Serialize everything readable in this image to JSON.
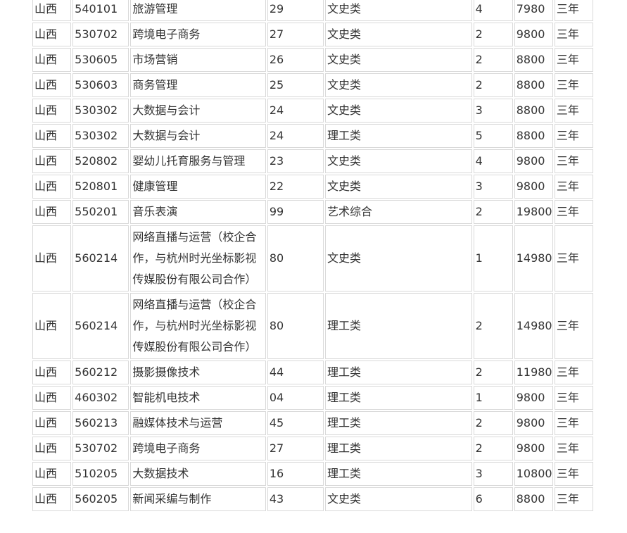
{
  "rows": [
    {
      "province": "山西",
      "code": "540101",
      "major": "旅游管理",
      "major_code": "29",
      "category": "文史类",
      "plan": "4",
      "fee": "7980",
      "years": "三年"
    },
    {
      "province": "山西",
      "code": "530702",
      "major": "跨境电子商务",
      "major_code": "27",
      "category": "文史类",
      "plan": "2",
      "fee": "9800",
      "years": "三年"
    },
    {
      "province": "山西",
      "code": "530605",
      "major": "市场营销",
      "major_code": "26",
      "category": "文史类",
      "plan": "2",
      "fee": "8800",
      "years": "三年"
    },
    {
      "province": "山西",
      "code": "530603",
      "major": "商务管理",
      "major_code": "25",
      "category": "文史类",
      "plan": "2",
      "fee": "8800",
      "years": "三年"
    },
    {
      "province": "山西",
      "code": "530302",
      "major": "大数据与会计",
      "major_code": "24",
      "category": "文史类",
      "plan": "3",
      "fee": "8800",
      "years": "三年"
    },
    {
      "province": "山西",
      "code": "530302",
      "major": "大数据与会计",
      "major_code": "24",
      "category": "理工类",
      "plan": "5",
      "fee": "8800",
      "years": "三年"
    },
    {
      "province": "山西",
      "code": "520802",
      "major": "婴幼儿托育服务与管理",
      "major_code": "23",
      "category": "文史类",
      "plan": "4",
      "fee": "9800",
      "years": "三年"
    },
    {
      "province": "山西",
      "code": "520801",
      "major": "健康管理",
      "major_code": "22",
      "category": "文史类",
      "plan": "3",
      "fee": "9800",
      "years": "三年"
    },
    {
      "province": "山西",
      "code": "550201",
      "major": "音乐表演",
      "major_code": "99",
      "category": "艺术综合",
      "plan": "2",
      "fee": "19800",
      "years": "三年"
    },
    {
      "province": "山西",
      "code": "560214",
      "major": "网络直播与运营（校企合作，与杭州时光坐标影视传媒股份有限公司合作）",
      "major_code": "80",
      "category": "文史类",
      "plan": "1",
      "fee": "14980",
      "years": "三年"
    },
    {
      "province": "山西",
      "code": "560214",
      "major": "网络直播与运营（校企合作，与杭州时光坐标影视传媒股份有限公司合作）",
      "major_code": "80",
      "category": "理工类",
      "plan": "2",
      "fee": "14980",
      "years": "三年"
    },
    {
      "province": "山西",
      "code": "560212",
      "major": "摄影摄像技术",
      "major_code": "44",
      "category": "理工类",
      "plan": "2",
      "fee": "11980",
      "years": "三年"
    },
    {
      "province": "山西",
      "code": "460302",
      "major": "智能机电技术",
      "major_code": "04",
      "category": "理工类",
      "plan": "1",
      "fee": "9800",
      "years": "三年"
    },
    {
      "province": "山西",
      "code": "560213",
      "major": "融媒体技术与运营",
      "major_code": "45",
      "category": "理工类",
      "plan": "2",
      "fee": "9800",
      "years": "三年"
    },
    {
      "province": "山西",
      "code": "530702",
      "major": "跨境电子商务",
      "major_code": "27",
      "category": "理工类",
      "plan": "2",
      "fee": "9800",
      "years": "三年"
    },
    {
      "province": "山西",
      "code": "510205",
      "major": "大数据技术",
      "major_code": "16",
      "category": "理工类",
      "plan": "3",
      "fee": "10800",
      "years": "三年"
    },
    {
      "province": "山西",
      "code": "560205",
      "major": "新闻采编与制作",
      "major_code": "43",
      "category": "文史类",
      "plan": "6",
      "fee": "8800",
      "years": "三年"
    }
  ]
}
